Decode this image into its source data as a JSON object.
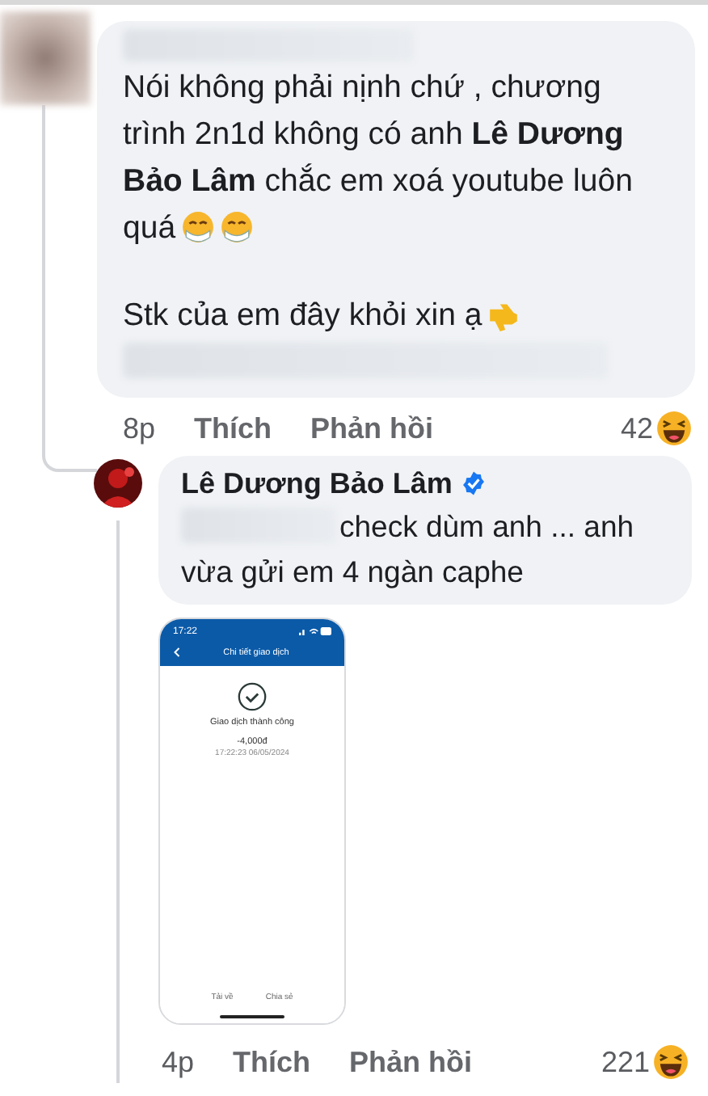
{
  "comment": {
    "text": "Nói không phải nịnh chứ , chương trình 2n1d không có anh **Lê Dương Bảo Lâm** chắc em xoá youtube luôn",
    "text_end": "quá",
    "note": "Stk của em đây khỏi xin ạ",
    "time": "8p",
    "like": "Thích",
    "reply": "Phản hồi",
    "reaction_count": "42"
  },
  "reply": {
    "author": "Lê Dương Bảo Lâm",
    "verified": true,
    "text_lines": [
      "check dùm anh ... anh",
      "vừa gửi em 4 ngàn caphe"
    ],
    "time": "4p",
    "like": "Thích",
    "reply": "Phản hồi",
    "reaction_count": "221",
    "attachment": {
      "status_time": "17:22",
      "title": "Chi tiết giao dịch",
      "result": "Giao dịch thành công",
      "amount": "-4,000đ",
      "timestamp": "17:22:23 06/05/2024",
      "actions": [
        "Tải về",
        "Chia sẻ"
      ]
    }
  }
}
